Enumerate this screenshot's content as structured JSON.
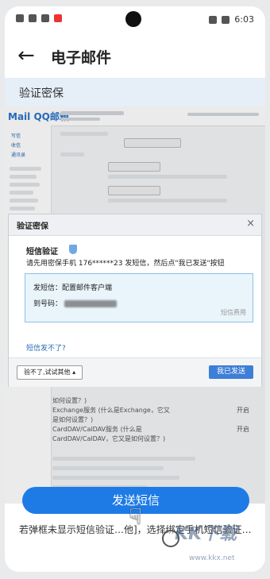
{
  "status_bar": {
    "time": "6:03"
  },
  "app_bar": {
    "title": "电子邮件"
  },
  "section_header": "验证密保",
  "qq_mail": {
    "logo": "Mail QQ邮箱",
    "sidebar_items": [
      "写信",
      "收信",
      "通讯录"
    ]
  },
  "dialog": {
    "title": "验证密保",
    "close": "×",
    "sms_heading": "短信验证",
    "instruction": "请先用密保手机 176******23 发短信，然后点\"我已发送\"按钮",
    "sms_content_label": "发短信：配置邮件客户端",
    "sms_to_label": "到号码：",
    "fee_link": "短信费用",
    "cant_send_link": "短信发不了?",
    "try_other_button": "验不了,试试其他 ▴",
    "sent_button": "我已发送"
  },
  "background_settings": {
    "lines": [
      "如何设置？)",
      "Exchange服务 (什么是Exchange，它又",
      "是如何设置？)",
      "CardDAV/CalDAV服务 (什么是",
      "CardDAV/CalDAV，它又是如何设置？)"
    ],
    "state_on": "开启",
    "state_on2": "开启"
  },
  "send_button": "发送短信",
  "bottom_text": "若弹框未显示短信验证…他]，选择绑定手机短信验证…",
  "watermark": {
    "brand": "KK下载",
    "url": "www.kkx.net"
  }
}
